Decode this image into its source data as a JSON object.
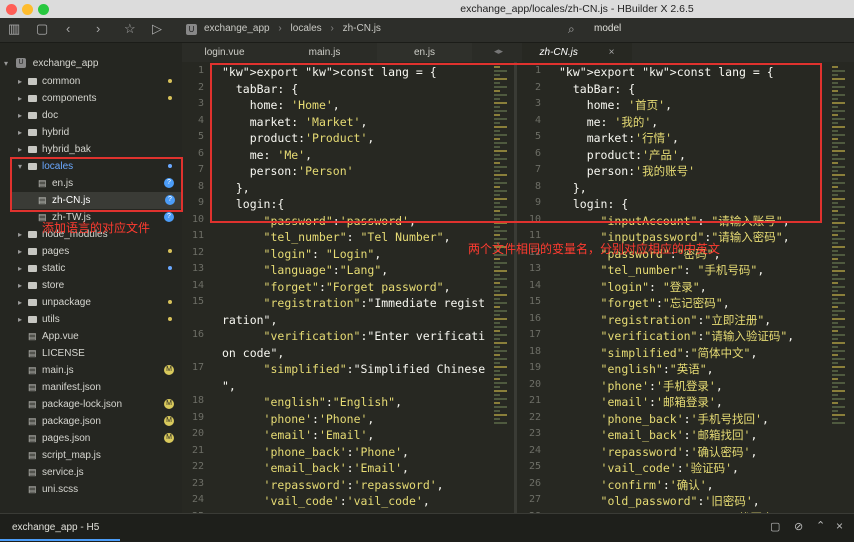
{
  "window": {
    "title": "exchange_app/locales/zh-CN.js - HBuilder X 2.6.5"
  },
  "toolbar": {
    "breadcrumb": [
      "exchange_app",
      "locales",
      "zh-CN.js"
    ],
    "search_label": "model"
  },
  "sidebar": {
    "root": "exchange_app",
    "items": [
      {
        "label": "common",
        "type": "folder",
        "marker": "dot"
      },
      {
        "label": "components",
        "type": "folder",
        "marker": "dot"
      },
      {
        "label": "doc",
        "type": "folder",
        "marker": ""
      },
      {
        "label": "hybrid",
        "type": "folder",
        "marker": ""
      },
      {
        "label": "hybrid_bak",
        "type": "folder",
        "marker": ""
      },
      {
        "label": "locales",
        "type": "folder-open",
        "marker": "dot-blue"
      },
      {
        "label": "en.js",
        "type": "file",
        "marker": "badge-blue"
      },
      {
        "label": "zh-CN.js",
        "type": "file",
        "marker": "badge-blue"
      },
      {
        "label": "zh-TW.js",
        "type": "file",
        "marker": "badge-blue"
      },
      {
        "label": "node_modules",
        "type": "folder",
        "marker": ""
      },
      {
        "label": "pages",
        "type": "folder",
        "marker": "dot"
      },
      {
        "label": "static",
        "type": "folder",
        "marker": "dot-blue"
      },
      {
        "label": "store",
        "type": "folder",
        "marker": ""
      },
      {
        "label": "unpackage",
        "type": "folder",
        "marker": "dot"
      },
      {
        "label": "utils",
        "type": "folder",
        "marker": "dot"
      },
      {
        "label": "App.vue",
        "type": "file",
        "marker": ""
      },
      {
        "label": "LICENSE",
        "type": "file",
        "marker": ""
      },
      {
        "label": "main.js",
        "type": "file",
        "marker": "badge"
      },
      {
        "label": "manifest.json",
        "type": "file",
        "marker": ""
      },
      {
        "label": "package-lock.json",
        "type": "file",
        "marker": "badge"
      },
      {
        "label": "package.json",
        "type": "file",
        "marker": "badge"
      },
      {
        "label": "pages.json",
        "type": "file",
        "marker": "badge"
      },
      {
        "label": "script_map.js",
        "type": "file",
        "marker": ""
      },
      {
        "label": "service.js",
        "type": "file",
        "marker": ""
      },
      {
        "label": "uni.scss",
        "type": "file",
        "marker": ""
      }
    ],
    "badge_letter": "M",
    "badge_question": "?"
  },
  "tabs": {
    "left": [
      "login.vue",
      "main.js",
      "en.js"
    ],
    "right": "zh-CN.js",
    "close_glyph": "×"
  },
  "left_code": [
    {
      "n": "1",
      "t": "export const lang = {"
    },
    {
      "n": "2",
      "t": "  tabBar: {"
    },
    {
      "n": "3",
      "t": "    home: 'Home',"
    },
    {
      "n": "4",
      "t": "    market: 'Market',"
    },
    {
      "n": "5",
      "t": "    product:'Product',"
    },
    {
      "n": "6",
      "t": "    me: 'Me',"
    },
    {
      "n": "7",
      "t": "    person:'Person'"
    },
    {
      "n": "8",
      "t": "  },"
    },
    {
      "n": "9",
      "t": "  login:{"
    },
    {
      "n": "10",
      "t": "      \"password\":'password',"
    },
    {
      "n": "11",
      "t": "      \"tel_number\": \"Tel Number\","
    },
    {
      "n": "12",
      "t": "      \"login\": \"Login\","
    },
    {
      "n": "13",
      "t": "      \"language\":\"Lang\","
    },
    {
      "n": "14",
      "t": "      \"forget\":\"Forget password\","
    },
    {
      "n": "15",
      "t": "      \"registration\":\"Immediate regist"
    },
    {
      "n": "",
      "t": "ration\","
    },
    {
      "n": "16",
      "t": "      \"verification\":\"Enter verificati"
    },
    {
      "n": "",
      "t": "on code\","
    },
    {
      "n": "17",
      "t": "      \"simplified\":\"Simplified Chinese"
    },
    {
      "n": "",
      "t": "\","
    },
    {
      "n": "18",
      "t": "      \"english\":\"English\","
    },
    {
      "n": "19",
      "t": "      'phone':'Phone',"
    },
    {
      "n": "20",
      "t": "      'email':'Email',"
    },
    {
      "n": "21",
      "t": "      'phone_back':'Phone',"
    },
    {
      "n": "22",
      "t": "      'email_back':'Email',"
    },
    {
      "n": "23",
      "t": "      'repassword':'repassword',"
    },
    {
      "n": "24",
      "t": "      'vail_code':'vail_code',"
    },
    {
      "n": "25",
      "t": "      'confirm':'submit',"
    }
  ],
  "right_code": [
    {
      "n": "1",
      "t": "export const lang = {"
    },
    {
      "n": "2",
      "t": "  tabBar: {"
    },
    {
      "n": "3",
      "t": "    home: '首页',"
    },
    {
      "n": "4",
      "t": "    me: '我的',"
    },
    {
      "n": "5",
      "t": "    market:'行情',"
    },
    {
      "n": "6",
      "t": "    product:'产品',"
    },
    {
      "n": "7",
      "t": "    person:'我的账号'"
    },
    {
      "n": "8",
      "t": "  },"
    },
    {
      "n": "9",
      "t": "  login: {"
    },
    {
      "n": "10",
      "t": "      \"inputAccount\": \"请输入账号\","
    },
    {
      "n": "11",
      "t": "      \"inputpassword\":\"请输入密码\","
    },
    {
      "n": "12",
      "t": "      \"password\":\"密码\","
    },
    {
      "n": "13",
      "t": "      \"tel_number\": \"手机号码\","
    },
    {
      "n": "14",
      "t": "      \"login\": \"登录\","
    },
    {
      "n": "15",
      "t": "      \"forget\":\"忘记密码\","
    },
    {
      "n": "16",
      "t": "      \"registration\":\"立即注册\","
    },
    {
      "n": "17",
      "t": "      \"verification\":\"请输入验证码\","
    },
    {
      "n": "18",
      "t": "      \"simplified\":\"简体中文\","
    },
    {
      "n": "19",
      "t": "      \"english\":\"英语\","
    },
    {
      "n": "20",
      "t": "      'phone':'手机登录',"
    },
    {
      "n": "21",
      "t": "      'email':'邮箱登录',"
    },
    {
      "n": "22",
      "t": "      'phone_back':'手机号找回',"
    },
    {
      "n": "23",
      "t": "      'email_back':'邮箱找回',"
    },
    {
      "n": "24",
      "t": "      'repassword':'确认密码',"
    },
    {
      "n": "25",
      "t": "      'vail_code':'验证码',"
    },
    {
      "n": "26",
      "t": "      'confirm':'确认',"
    },
    {
      "n": "27",
      "t": "      \"old_password\":'旧密码',"
    },
    {
      "n": "28",
      "t": "      'Recover_password':'找回密码',"
    }
  ],
  "annotations": {
    "sidebar_note": "添加语言的对应文件",
    "code_note": "两个文件相同的变量名，分别对应相应的中英文"
  },
  "status": {
    "project": "exchange_app - H5"
  },
  "colors": {
    "keyword": "#f92672",
    "string": "#e6db74",
    "annotation": "#ff3b30",
    "editor_bg": "#272822"
  }
}
